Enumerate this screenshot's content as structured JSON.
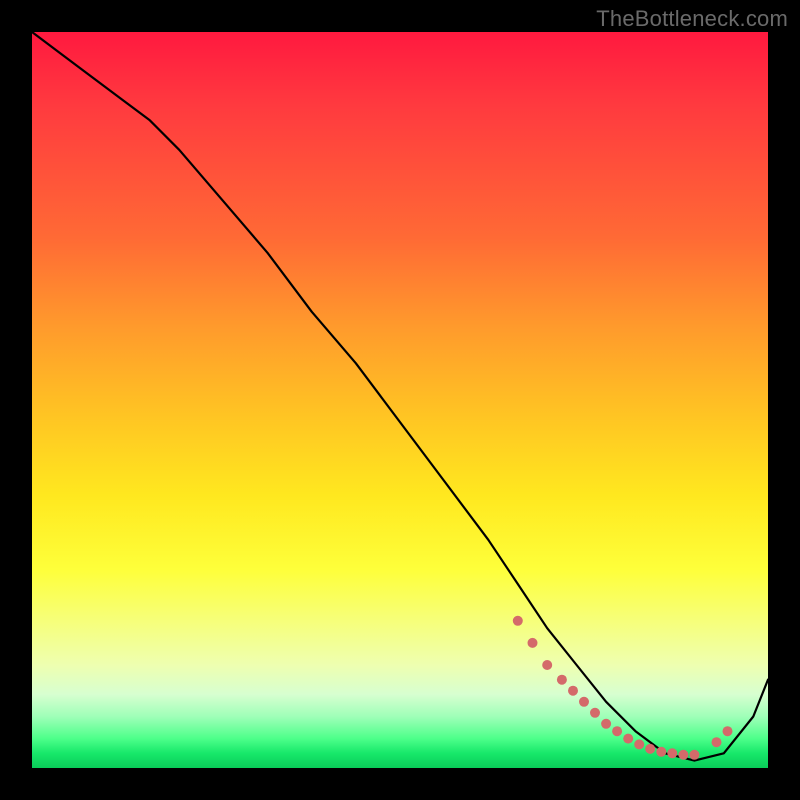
{
  "watermark": "TheBottleneck.com",
  "chart_data": {
    "type": "line",
    "title": "",
    "xlabel": "",
    "ylabel": "",
    "xlim": [
      0,
      100
    ],
    "ylim": [
      0,
      100
    ],
    "series": [
      {
        "name": "curve",
        "x": [
          0,
          4,
          8,
          12,
          16,
          20,
          26,
          32,
          38,
          44,
          50,
          56,
          62,
          66,
          70,
          74,
          78,
          82,
          86,
          90,
          94,
          98,
          100
        ],
        "y": [
          100,
          97,
          94,
          91,
          88,
          84,
          77,
          70,
          62,
          55,
          47,
          39,
          31,
          25,
          19,
          14,
          9,
          5,
          2,
          1,
          2,
          7,
          12
        ]
      }
    ],
    "markers": {
      "name": "dots",
      "color": "#d46a6a",
      "x": [
        66,
        68,
        70,
        72,
        73.5,
        75,
        76.5,
        78,
        79.5,
        81,
        82.5,
        84,
        85.5,
        87,
        88.5,
        90,
        93,
        94.5
      ],
      "y": [
        20,
        17,
        14,
        12,
        10.5,
        9,
        7.5,
        6,
        5,
        4,
        3.2,
        2.6,
        2.2,
        2,
        1.8,
        1.8,
        3.5,
        5
      ]
    }
  }
}
